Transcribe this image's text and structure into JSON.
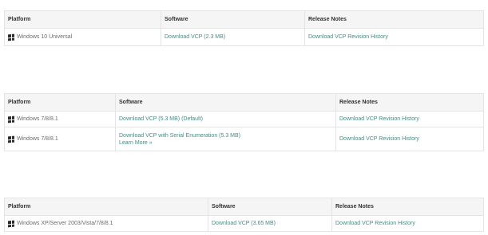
{
  "headers": {
    "platform": "Platform",
    "software": "Software",
    "release_notes": "Release Notes"
  },
  "tables": [
    {
      "rows": [
        {
          "platform": "Windows 10 Universal",
          "software": [
            "Download VCP (2.3 MB)"
          ],
          "notes": "Download VCP Revision History"
        }
      ]
    },
    {
      "rows": [
        {
          "platform": "Windows 7/8/8.1",
          "software": [
            "Download VCP (5.3 MB) (Default)"
          ],
          "notes": "Download VCP Revision History"
        },
        {
          "platform": "Windows 7/8/8.1",
          "software": [
            "Download VCP with Serial Enumeration (5.3 MB)",
            "Learn More »"
          ],
          "notes": "Download VCP Revision History"
        }
      ]
    },
    {
      "rows": [
        {
          "platform": "Windows XP/Server 2003/Vista/7/8/8.1",
          "software": [
            "Download VCP (3.65 MB)"
          ],
          "notes": "Download VCP Revision History"
        }
      ]
    }
  ]
}
